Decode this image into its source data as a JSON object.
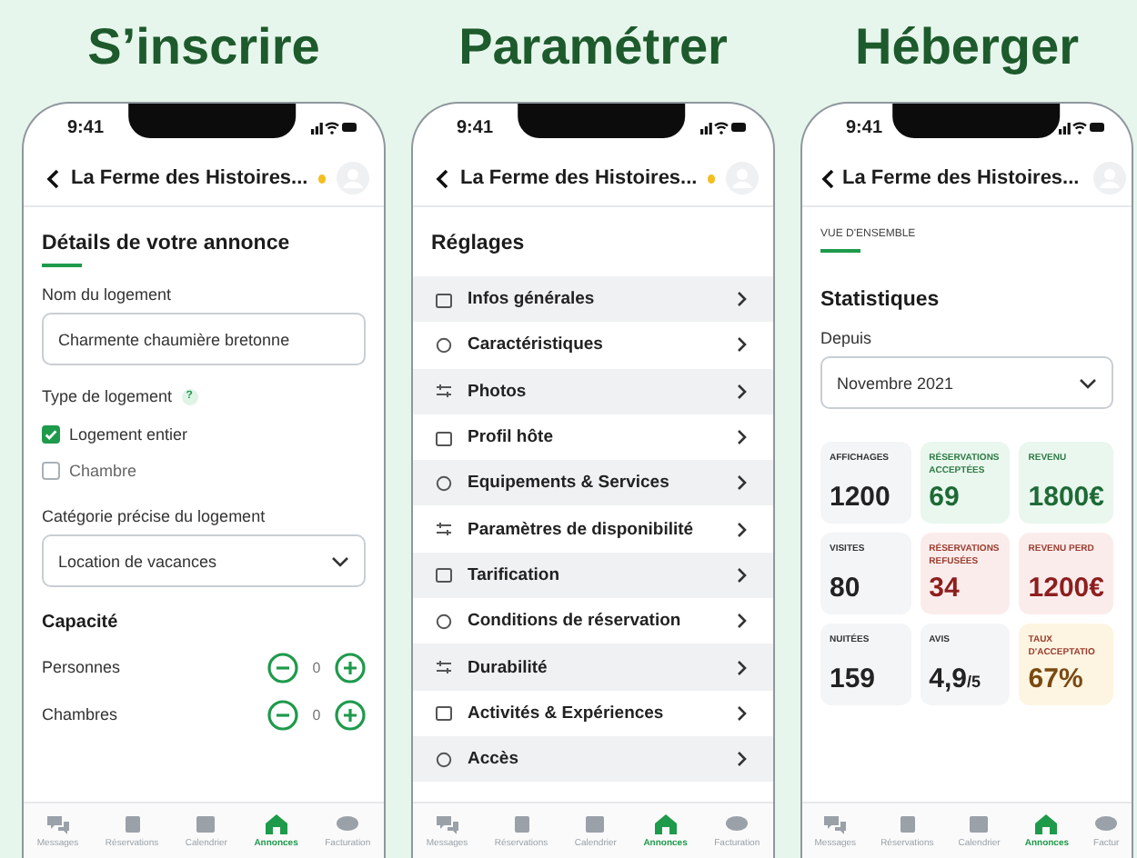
{
  "headings": [
    "S’inscrire",
    "Paramétrer",
    "Héberger"
  ],
  "phones": [
    {
      "kind": "form",
      "time": "9:41",
      "title": "La Ferme des Histoires...",
      "form": {
        "title": "Détails de votre annonce",
        "name_label": "Nom du logement",
        "name_value": "Charmente chaumière bretonne",
        "type_label": "Type de logement",
        "help": "?",
        "types": [
          {
            "label": "Logement entier",
            "checked": true
          },
          {
            "label": "Chambre",
            "checked": false
          }
        ],
        "category_label": "Catégorie précise du logement",
        "category_value": "Location de vacances",
        "capacity_title": "Capacité",
        "counters": [
          {
            "label": "Personnes",
            "value": "0"
          },
          {
            "label": "Chambres",
            "value": "0"
          }
        ]
      },
      "tabs": [
        {
          "label": "Messages",
          "selected": false
        },
        {
          "label": "Réservations",
          "selected": false
        },
        {
          "label": "Calendrier",
          "selected": false
        },
        {
          "label": "Annonces",
          "selected": true
        },
        {
          "label": "Facturation",
          "selected": false
        }
      ]
    },
    {
      "kind": "settings",
      "time": "9:41",
      "title": "La Ferme des Histoires...",
      "settings": {
        "title": "Réglages",
        "items": [
          "Infos générales",
          "Caractéristiques",
          "Photos",
          "Profil hôte",
          "Equipements & Services",
          "Paramètres de disponibilité",
          "Tarification",
          "Conditions de réservation",
          "Durabilité",
          "Activités & Expériences",
          "Accès"
        ]
      },
      "tabs": [
        {
          "label": "Messages",
          "selected": false
        },
        {
          "label": "Réservations",
          "selected": false
        },
        {
          "label": "Calendrier",
          "selected": false
        },
        {
          "label": "Annonces",
          "selected": true
        },
        {
          "label": "Facturation",
          "selected": false
        }
      ]
    },
    {
      "kind": "stats",
      "time": "9:41",
      "title": "La Ferme des Histoires...",
      "stats": {
        "tab": "VUE D'ENSEMBLE",
        "title": "Statistiques",
        "since_label": "Depuis",
        "since_value": "Novembre 2021",
        "cards": [
          {
            "label": "AFFICHAGES",
            "value": "1200",
            "kind": "neutral"
          },
          {
            "label": "RÉSERVATIONS ACCEPTÉES",
            "value": "69",
            "kind": "positive"
          },
          {
            "label": "REVENU",
            "value": "1800€",
            "kind": "positive"
          },
          {
            "label": "VISITES",
            "value": "80",
            "kind": "neutral"
          },
          {
            "label": "RÉSERVATIONS REFUSÉES",
            "value": "34",
            "kind": "negative"
          },
          {
            "label": "REVENU PERD",
            "value": "1200€",
            "kind": "negative"
          },
          {
            "label": "NUITÉES",
            "value": "159",
            "kind": "neutral"
          },
          {
            "label": "AVIS",
            "value": "4,9",
            "suffix": "/5",
            "kind": "neutral"
          },
          {
            "label": "TAUX D'ACCEPTATIO",
            "value": "67%",
            "kind": "warning"
          }
        ]
      },
      "tabs": [
        {
          "label": "Messages",
          "selected": false
        },
        {
          "label": "Réservations",
          "selected": false
        },
        {
          "label": "Calendrier",
          "selected": false
        },
        {
          "label": "Annonces",
          "selected": true
        },
        {
          "label": "Factur",
          "selected": false
        }
      ]
    }
  ]
}
